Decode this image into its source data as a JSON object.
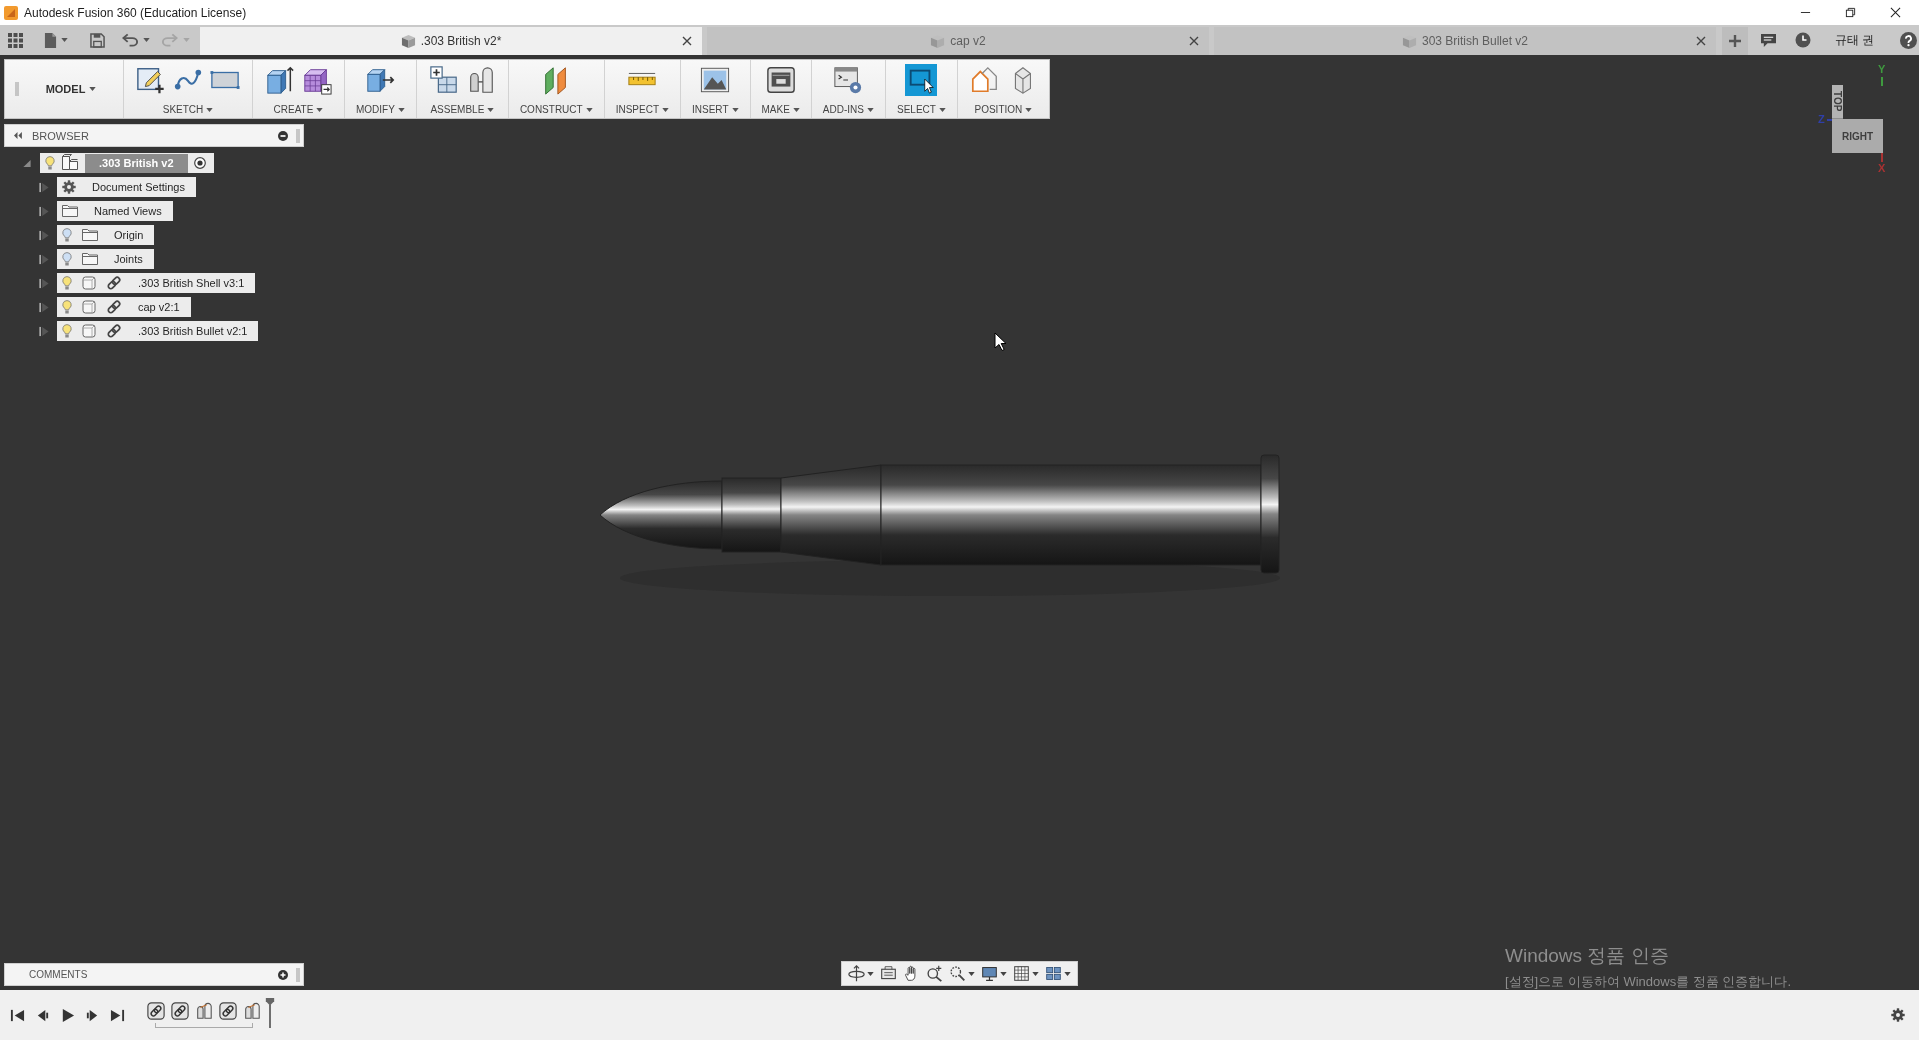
{
  "window": {
    "title": "Autodesk Fusion 360 (Education License)"
  },
  "quick_access": {
    "redo_disabled": true
  },
  "tabs": [
    {
      "label": ".303 British v2*",
      "selected": true
    },
    {
      "label": "cap v2",
      "selected": false
    },
    {
      "label": "303 British Bullet v2",
      "selected": false
    }
  ],
  "user": {
    "name": "규태 권"
  },
  "toolbar": {
    "workspace": "MODEL",
    "groups": [
      {
        "label": "SKETCH",
        "selected": false
      },
      {
        "label": "CREATE",
        "selected": false
      },
      {
        "label": "MODIFY",
        "selected": false
      },
      {
        "label": "ASSEMBLE",
        "selected": false
      },
      {
        "label": "CONSTRUCT",
        "selected": false
      },
      {
        "label": "INSPECT",
        "selected": false
      },
      {
        "label": "INSERT",
        "selected": false
      },
      {
        "label": "MAKE",
        "selected": false
      },
      {
        "label": "ADD-INS",
        "selected": false
      },
      {
        "label": "SELECT",
        "selected": true
      },
      {
        "label": "POSITION",
        "selected": false
      }
    ]
  },
  "browser": {
    "title": "BROWSER",
    "root": {
      "label": ".303 British v2",
      "expanded": true,
      "visible": true,
      "active": true,
      "children": [
        {
          "label": "Document Settings",
          "kind": "settings",
          "expanded": false
        },
        {
          "label": "Named Views",
          "kind": "folder",
          "expanded": false
        },
        {
          "label": "Origin",
          "kind": "folder",
          "expanded": false,
          "visible": false
        },
        {
          "label": "Joints",
          "kind": "folder",
          "expanded": false,
          "visible": false
        },
        {
          "label": ".303 British Shell v3:1",
          "kind": "component",
          "expanded": false,
          "visible": true
        },
        {
          "label": "cap v2:1",
          "kind": "component",
          "expanded": false,
          "visible": true
        },
        {
          "label": ".303 British Bullet v2:1",
          "kind": "component",
          "expanded": false,
          "visible": true
        }
      ]
    }
  },
  "view_cube": {
    "top": "TOP",
    "front": "RIGHT",
    "axes": [
      {
        "label": "Y",
        "color": "#3f9a3f"
      },
      {
        "label": "Z",
        "color": "#2f3fa8"
      },
      {
        "label": "X",
        "color": "#a83232"
      }
    ]
  },
  "comments": {
    "title": "COMMENTS"
  },
  "activation_notice": {
    "title": "Windows 정품 인증",
    "message": "[설정]으로 이동하여 Windows를 정품 인증합니다."
  }
}
